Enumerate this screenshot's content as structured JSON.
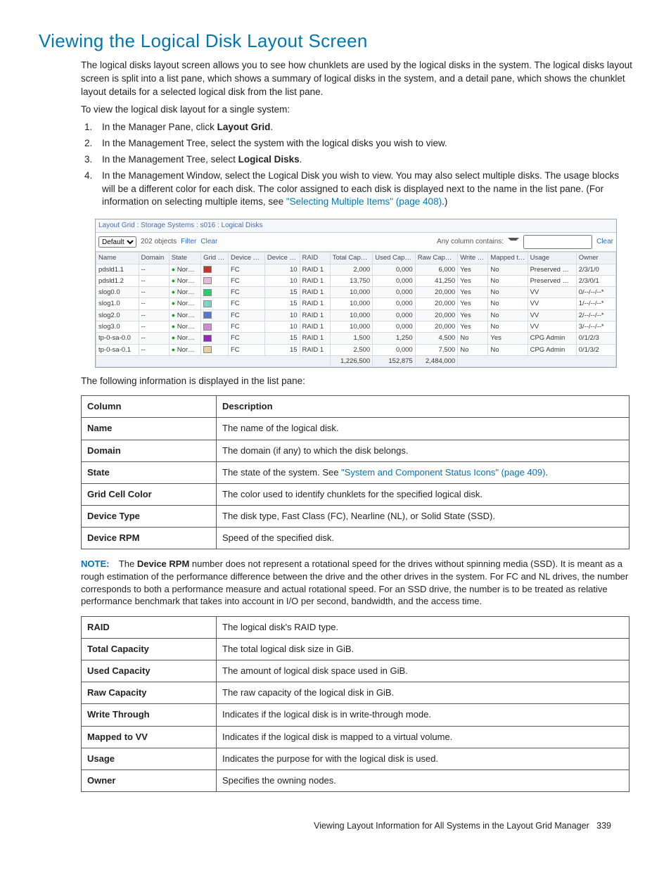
{
  "title": "Viewing the Logical Disk Layout Screen",
  "intro": "The logical disks layout screen allows you to see how chunklets are used by the logical disks in the system. The logical disks layout screen is split into a list pane, which shows a summary of logical disks in the system, and a detail pane, which shows the chunklet layout details for a selected logical disk from the list pane.",
  "to_view": "To view the logical disk layout for a single system:",
  "steps": {
    "s1a": "In the Manager Pane, click ",
    "s1b": "Layout Grid",
    "s1c": ".",
    "s2": "In the Management Tree, select the system with the logical disks you wish to view.",
    "s3a": "In the Management Tree, select ",
    "s3b": "Logical Disks",
    "s3c": ".",
    "s4a": "In the Management Window, select the Logical Disk you wish to view. You may also select multiple disks. The usage blocks will be a different color for each disk. The color assigned to each disk is displayed next to the name in the list pane. (For information on selecting multiple items, see ",
    "s4link": "\"Selecting Multiple Items\" (page 408)",
    "s4b": ".)"
  },
  "shot": {
    "breadcrumb": "Layout Grid : Storage Systems : s016 : Logical Disks",
    "dropdown": "Default",
    "objects": "202 objects",
    "filter": "Filter",
    "clear": "Clear",
    "any_col": "Any column contains:",
    "clear2": "Clear",
    "headers": [
      "Name",
      "Domain",
      "State",
      "Grid Cell Color",
      "Device Type",
      "Device RPM (K)",
      "RAID",
      "Total Capacity (GiB)",
      "Used Capacity (GiB)",
      "Raw Capacity (GiB)",
      "Write Through",
      "Mapped to VV",
      "Usage",
      "Owner"
    ],
    "rows": [
      {
        "name": "pdsld1.1",
        "domain": "--",
        "state": "Normal",
        "color": "#c0392b",
        "dt": "FC",
        "rpm": "10",
        "raid": "RAID 1",
        "tot": "2,000",
        "used": "0,000",
        "raw": "6,000",
        "wt": "Yes",
        "mv": "No",
        "usage": "Preserved Data",
        "owner": "2/3/1/0"
      },
      {
        "name": "pdsld1.2",
        "domain": "--",
        "state": "Normal",
        "color": "#e9b8d9",
        "dt": "FC",
        "rpm": "10",
        "raid": "RAID 1",
        "tot": "13,750",
        "used": "0,000",
        "raw": "41,250",
        "wt": "Yes",
        "mv": "No",
        "usage": "Preserved Data",
        "owner": "2/3/0/1"
      },
      {
        "name": "slog0.0",
        "domain": "--",
        "state": "Normal",
        "color": "#2ecc71",
        "dt": "FC",
        "rpm": "15",
        "raid": "RAID 1",
        "tot": "10,000",
        "used": "0,000",
        "raw": "20,000",
        "wt": "Yes",
        "mv": "No",
        "usage": "VV",
        "owner": "0/--/--/--*"
      },
      {
        "name": "slog1.0",
        "domain": "--",
        "state": "Normal",
        "color": "#7fd3c5",
        "dt": "FC",
        "rpm": "15",
        "raid": "RAID 1",
        "tot": "10,000",
        "used": "0,000",
        "raw": "20,000",
        "wt": "Yes",
        "mv": "No",
        "usage": "VV",
        "owner": "1/--/--/--*"
      },
      {
        "name": "slog2.0",
        "domain": "--",
        "state": "Normal",
        "color": "#5a78c8",
        "dt": "FC",
        "rpm": "10",
        "raid": "RAID 1",
        "tot": "10,000",
        "used": "0,000",
        "raw": "20,000",
        "wt": "Yes",
        "mv": "No",
        "usage": "VV",
        "owner": "2/--/--/--*"
      },
      {
        "name": "slog3.0",
        "domain": "--",
        "state": "Normal",
        "color": "#d18bd1",
        "dt": "FC",
        "rpm": "10",
        "raid": "RAID 1",
        "tot": "10,000",
        "used": "0,000",
        "raw": "20,000",
        "wt": "Yes",
        "mv": "No",
        "usage": "VV",
        "owner": "3/--/--/--*"
      },
      {
        "name": "tp-0-sa-0.0",
        "domain": "--",
        "state": "Normal",
        "color": "#8e2abf",
        "dt": "FC",
        "rpm": "15",
        "raid": "RAID 1",
        "tot": "1,500",
        "used": "1,250",
        "raw": "4,500",
        "wt": "No",
        "mv": "Yes",
        "usage": "CPG Admin",
        "owner": "0/1/2/3"
      },
      {
        "name": "tp-0-sa-0.1",
        "domain": "--",
        "state": "Normal",
        "color": "#e6cf9c",
        "dt": "FC",
        "rpm": "15",
        "raid": "RAID 1",
        "tot": "2,500",
        "used": "0,000",
        "raw": "7,500",
        "wt": "No",
        "mv": "No",
        "usage": "CPG Admin",
        "owner": "0/1/3/2"
      }
    ],
    "totals": {
      "tot": "1,226,500",
      "used": "152,875",
      "raw": "2,484,000"
    }
  },
  "listpane_intro": "The following information is displayed in the list pane:",
  "table1": {
    "h1": "Column",
    "h2": "Description",
    "rows": [
      [
        "Name",
        "The name of the logical disk."
      ],
      [
        "Domain",
        "The domain (if any) to which the disk belongs."
      ],
      [
        "State",
        ""
      ],
      [
        "Grid Cell Color",
        "The color used to identify chunklets for the specified logical disk."
      ],
      [
        "Device Type",
        "The disk type, Fast Class (FC), Nearline (NL), or Solid State (SSD)."
      ],
      [
        "Device RPM",
        "Speed of the specified disk."
      ]
    ],
    "state_pre": "The state of the system. See ",
    "state_link": "\"System and Component Status Icons\" (page 409)",
    "state_post": "."
  },
  "note": {
    "label": "NOTE:",
    "pre": "The ",
    "bold": "Device RPM",
    "post": " number does not represent a rotational speed for the drives without spinning media (SSD). It is meant as a rough estimation of the performance difference between the drive and the other drives in the system. For FC and NL drives, the number corresponds to both a performance measure and actual rotational speed. For an SSD drive, the number is to be treated as relative performance benchmark that takes into account in I/O per second, bandwidth, and the access time."
  },
  "table2": {
    "rows": [
      [
        "RAID",
        "The logical disk's RAID type."
      ],
      [
        "Total Capacity",
        "The total logical disk size in GiB."
      ],
      [
        "Used Capacity",
        "The amount of logical disk space used in GiB."
      ],
      [
        "Raw Capacity",
        "The raw capacity of the logical disk in GiB."
      ],
      [
        "Write Through",
        "Indicates if the logical disk is in write-through mode."
      ],
      [
        "Mapped to VV",
        "Indicates if the logical disk is mapped to a virtual volume."
      ],
      [
        "Usage",
        "Indicates the purpose for with the logical disk is used."
      ],
      [
        "Owner",
        "Specifies the owning nodes."
      ]
    ]
  },
  "footer": {
    "text": "Viewing Layout Information for All Systems in the Layout Grid Manager",
    "page": "339"
  }
}
